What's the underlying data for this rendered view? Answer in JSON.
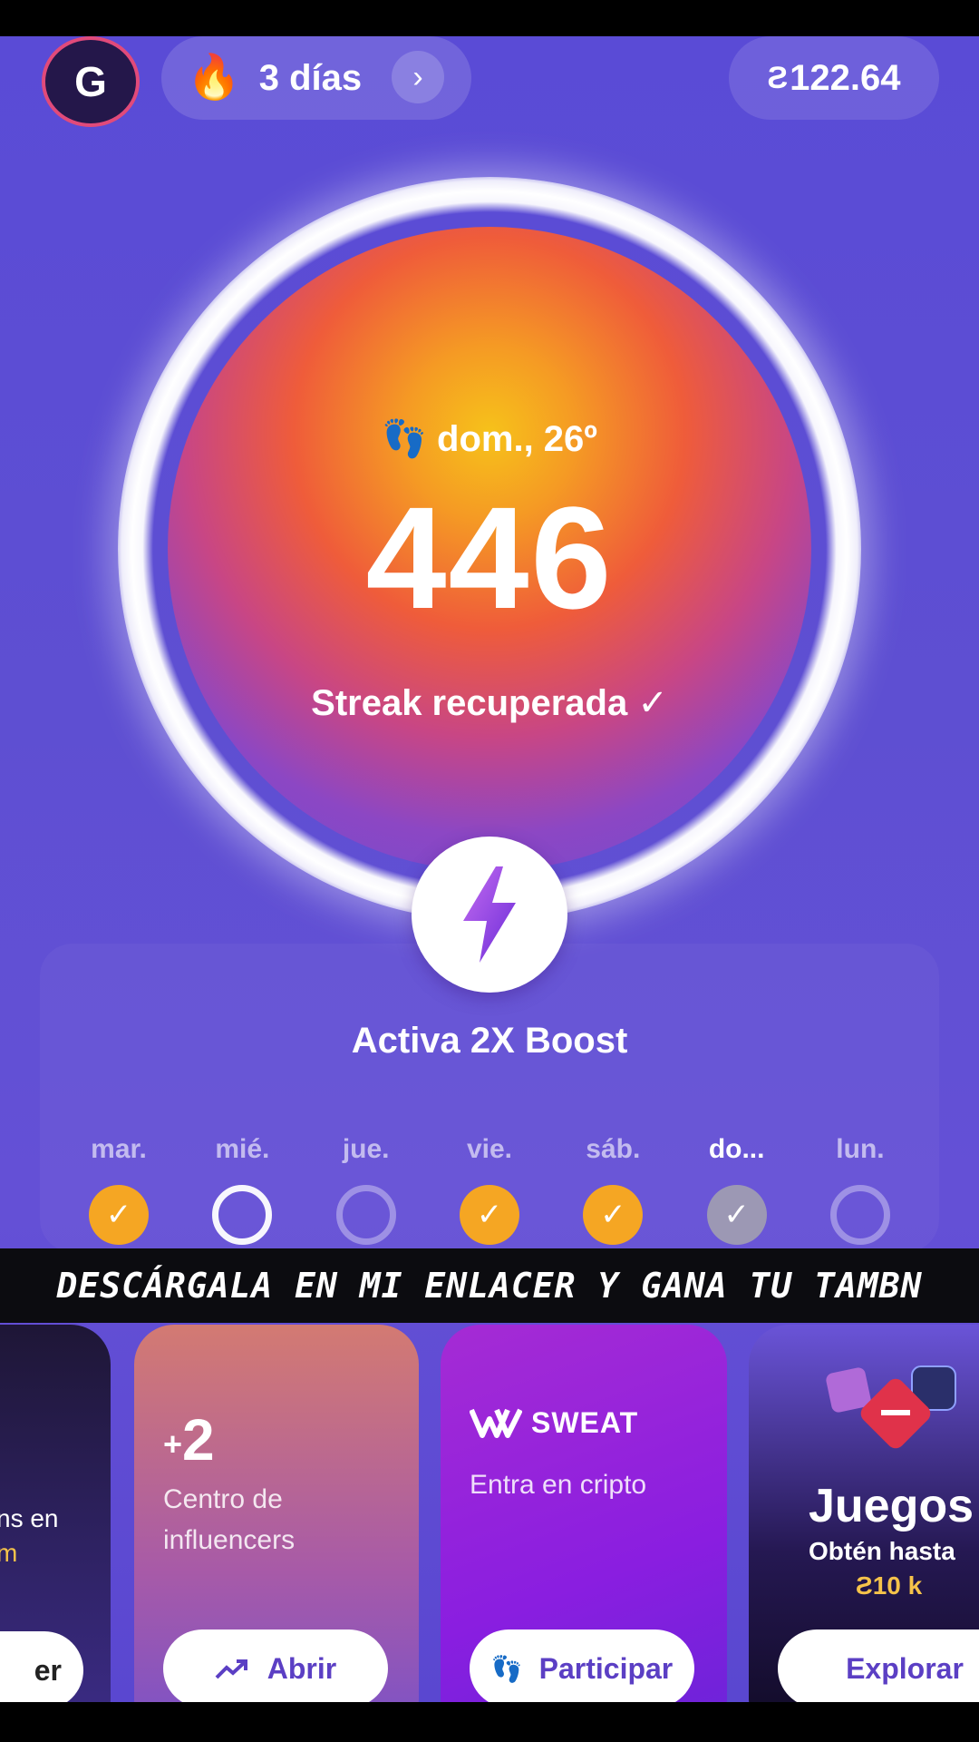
{
  "header": {
    "avatar_letter": "G",
    "streak_label": "3 días",
    "balance": "122.64",
    "balance_icon": "sweatcoin-icon"
  },
  "ring": {
    "date": "dom., 26º",
    "steps": "446",
    "status": "Streak recuperada ✓"
  },
  "boost": {
    "label": "Activa 2X Boost"
  },
  "week": [
    {
      "label": "mar.",
      "state": "done",
      "mark": "✓"
    },
    {
      "label": "mié.",
      "state": "open",
      "mark": ""
    },
    {
      "label": "jue.",
      "state": "partial",
      "mark": ""
    },
    {
      "label": "vie.",
      "state": "done",
      "mark": "✓"
    },
    {
      "label": "sáb.",
      "state": "done",
      "mark": "✓"
    },
    {
      "label": "do...",
      "state": "today",
      "mark": "✓"
    },
    {
      "label": "lun.",
      "state": "partial",
      "mark": ""
    }
  ],
  "banner": {
    "text": "DESCÁRGALA EN MI ENLACER Y GANA TU TAMBN"
  },
  "cards": {
    "card0": {
      "text": "ns en",
      "accent": "m",
      "button": "er"
    },
    "card1": {
      "plus_sign": "+",
      "plus_value": "2",
      "desc_line1": "Centro de",
      "desc_line2": "influencers",
      "button": "Abrir"
    },
    "card2": {
      "brand": "SWEAT",
      "desc": "Entra en cripto",
      "button": "Participar"
    },
    "card3": {
      "title": "Juegos",
      "sub": "Obtén hasta",
      "amount": "10 k",
      "button": "Explorar"
    }
  },
  "colors": {
    "background": "#5a4bd6",
    "accent_orange": "#f5a623",
    "accent_gold": "#f6c34a",
    "button_text": "#5b3fc4"
  }
}
